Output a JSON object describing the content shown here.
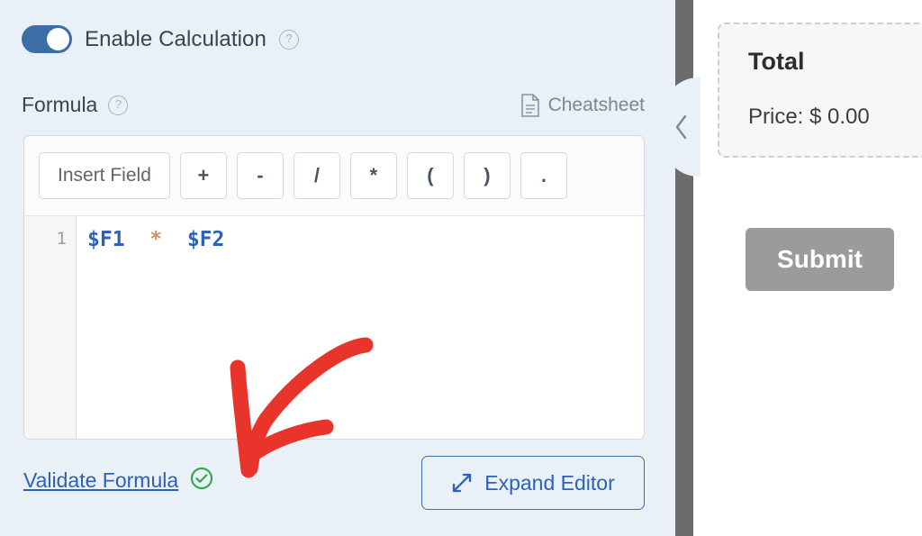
{
  "settings": {
    "toggle": {
      "label": "Enable Calculation",
      "state": "on",
      "help": "?",
      "color": "#3a6ea5"
    },
    "formula": {
      "title": "Formula",
      "help": "?",
      "cheatsheet_label": "Cheatsheet",
      "cheatsheet_icon": "document-icon",
      "toolbar": [
        {
          "label": "Insert Field",
          "name": "insert-field"
        },
        {
          "label": "+",
          "name": "plus"
        },
        {
          "label": "-",
          "name": "minus"
        },
        {
          "label": "/",
          "name": "divide"
        },
        {
          "label": "*",
          "name": "multiply"
        },
        {
          "label": "(",
          "name": "paren-open"
        },
        {
          "label": ")",
          "name": "paren-close"
        },
        {
          "label": ".",
          "name": "dot"
        }
      ],
      "line_number": "1",
      "code_tokens": [
        {
          "text": "$F1",
          "type": "var"
        },
        {
          "text": "  ",
          "type": "space"
        },
        {
          "text": "*",
          "type": "op"
        },
        {
          "text": "  ",
          "type": "space"
        },
        {
          "text": "$F2",
          "type": "var"
        }
      ],
      "code_plain": "$F1  *  $F2"
    },
    "validate_label": "Validate Formula",
    "validate_status_icon": "check-circle-icon",
    "validate_status_color": "#34a853",
    "expand_label": "Expand Editor",
    "expand_icon": "expand-arrows-icon",
    "collapse_icon": "chevron-left-icon"
  },
  "preview": {
    "total_title": "Total",
    "total_price": "Price: $ 0.00",
    "submit_label": "Submit",
    "submit_color": "#9b9b9b"
  },
  "annotation": {
    "type": "hand-drawn-arrow",
    "color": "#e8342a",
    "points_to": "validate-status-icon"
  }
}
